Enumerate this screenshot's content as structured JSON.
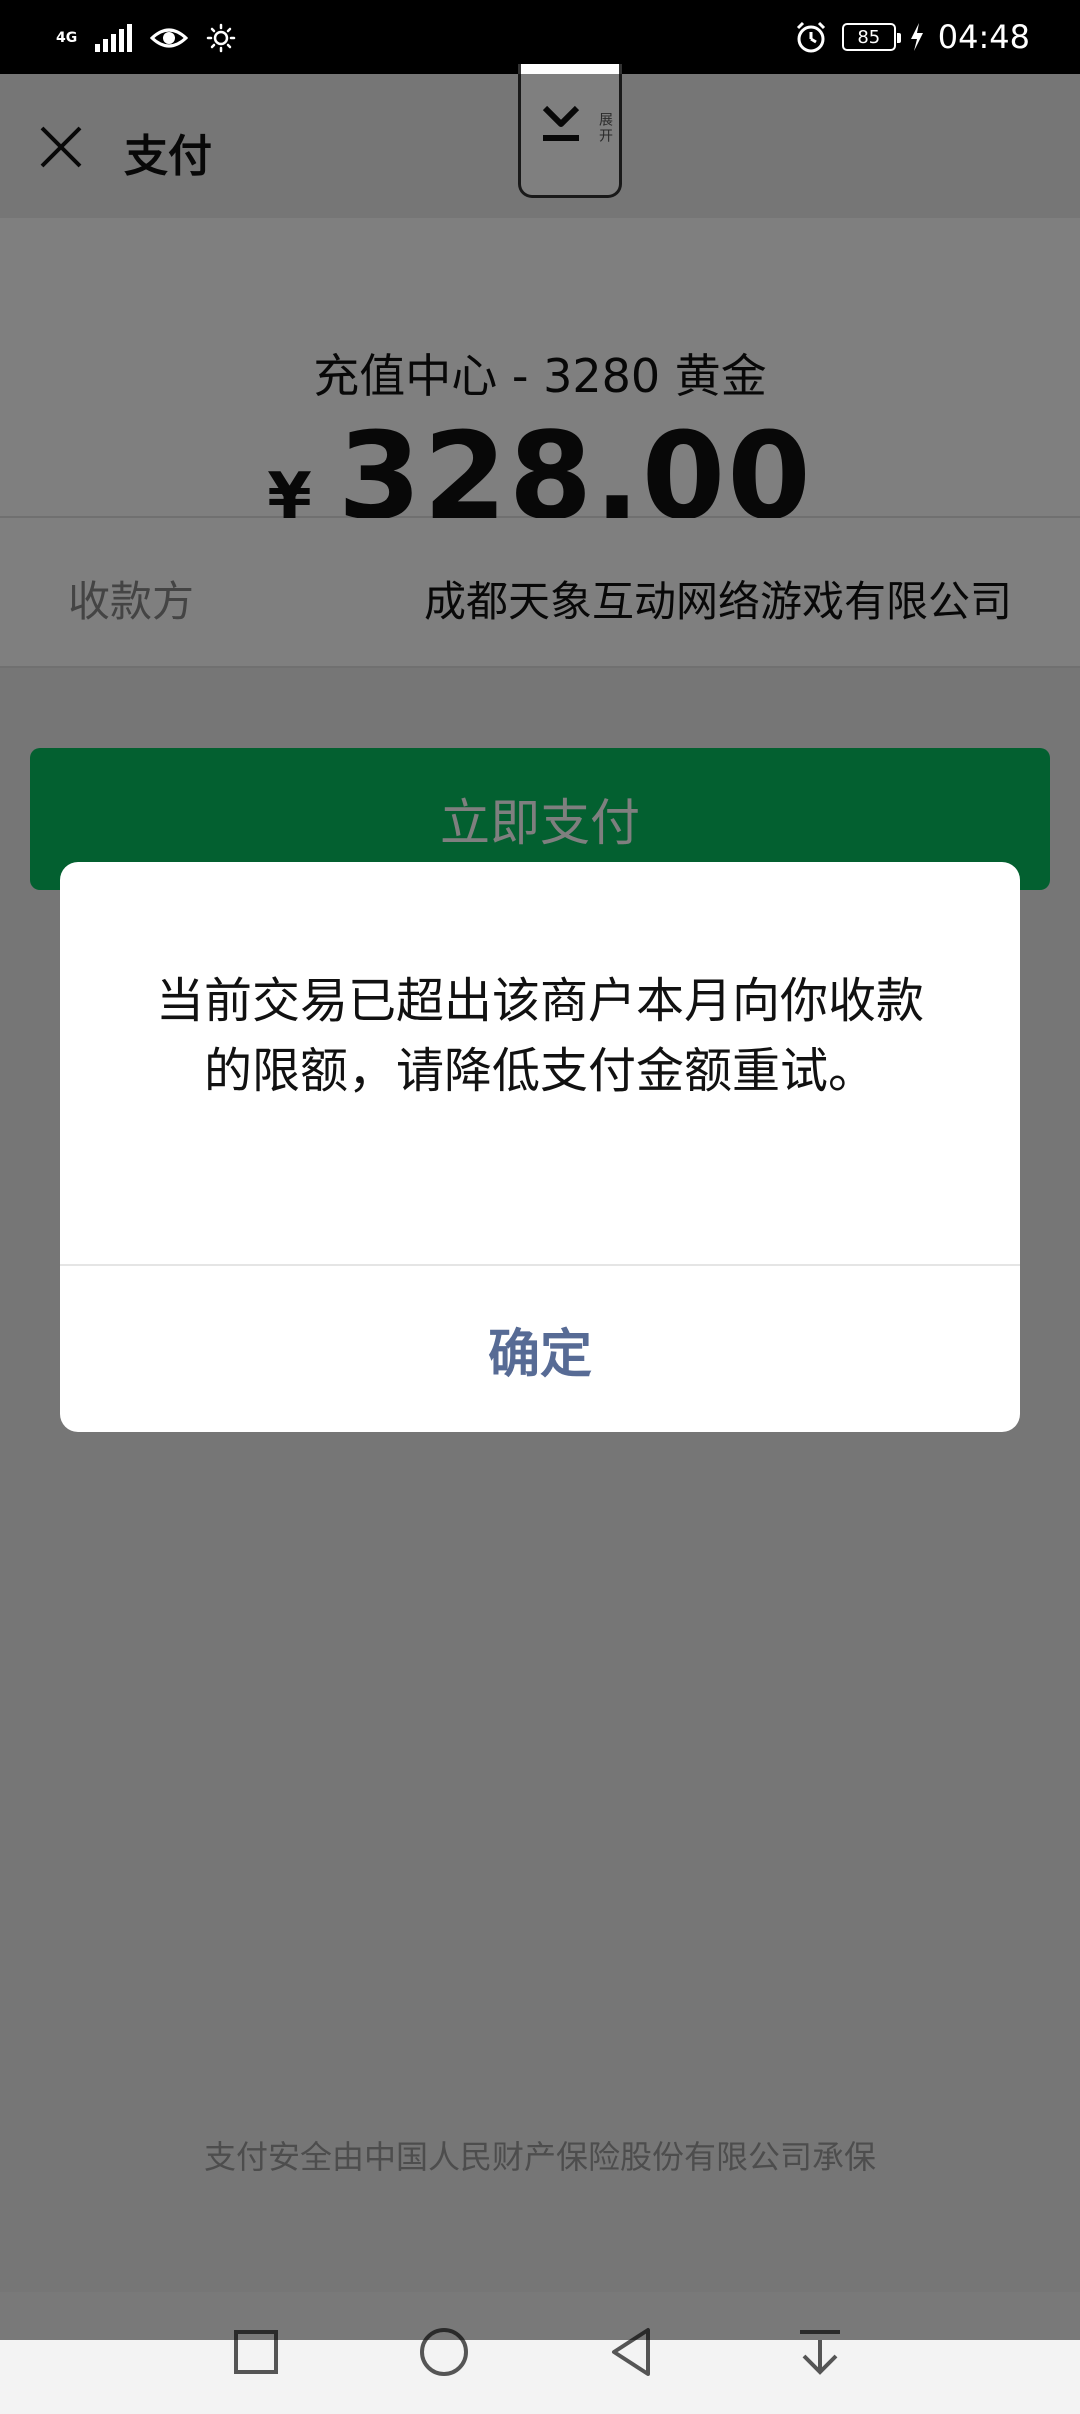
{
  "status_bar": {
    "network": "4G",
    "battery": "85",
    "time": "04:48"
  },
  "header": {
    "title": "支付"
  },
  "float_handle": {
    "label": "展开"
  },
  "order": {
    "title": "充值中心 - 3280 黄金",
    "currency": "¥",
    "amount": "328.00"
  },
  "payee": {
    "label": "收款方",
    "value": "成都天象互动网络游戏有限公司"
  },
  "pay_button": {
    "label": "立即支付"
  },
  "footer": {
    "note": "支付安全由中国人民财产保险股份有限公司承保"
  },
  "dialog": {
    "message": "当前交易已超出该商户本月向你收款的限额，请降低支付金额重试。",
    "confirm_label": "确定"
  },
  "colors": {
    "primary_green": "#07c160",
    "link_blue": "#576b95"
  }
}
